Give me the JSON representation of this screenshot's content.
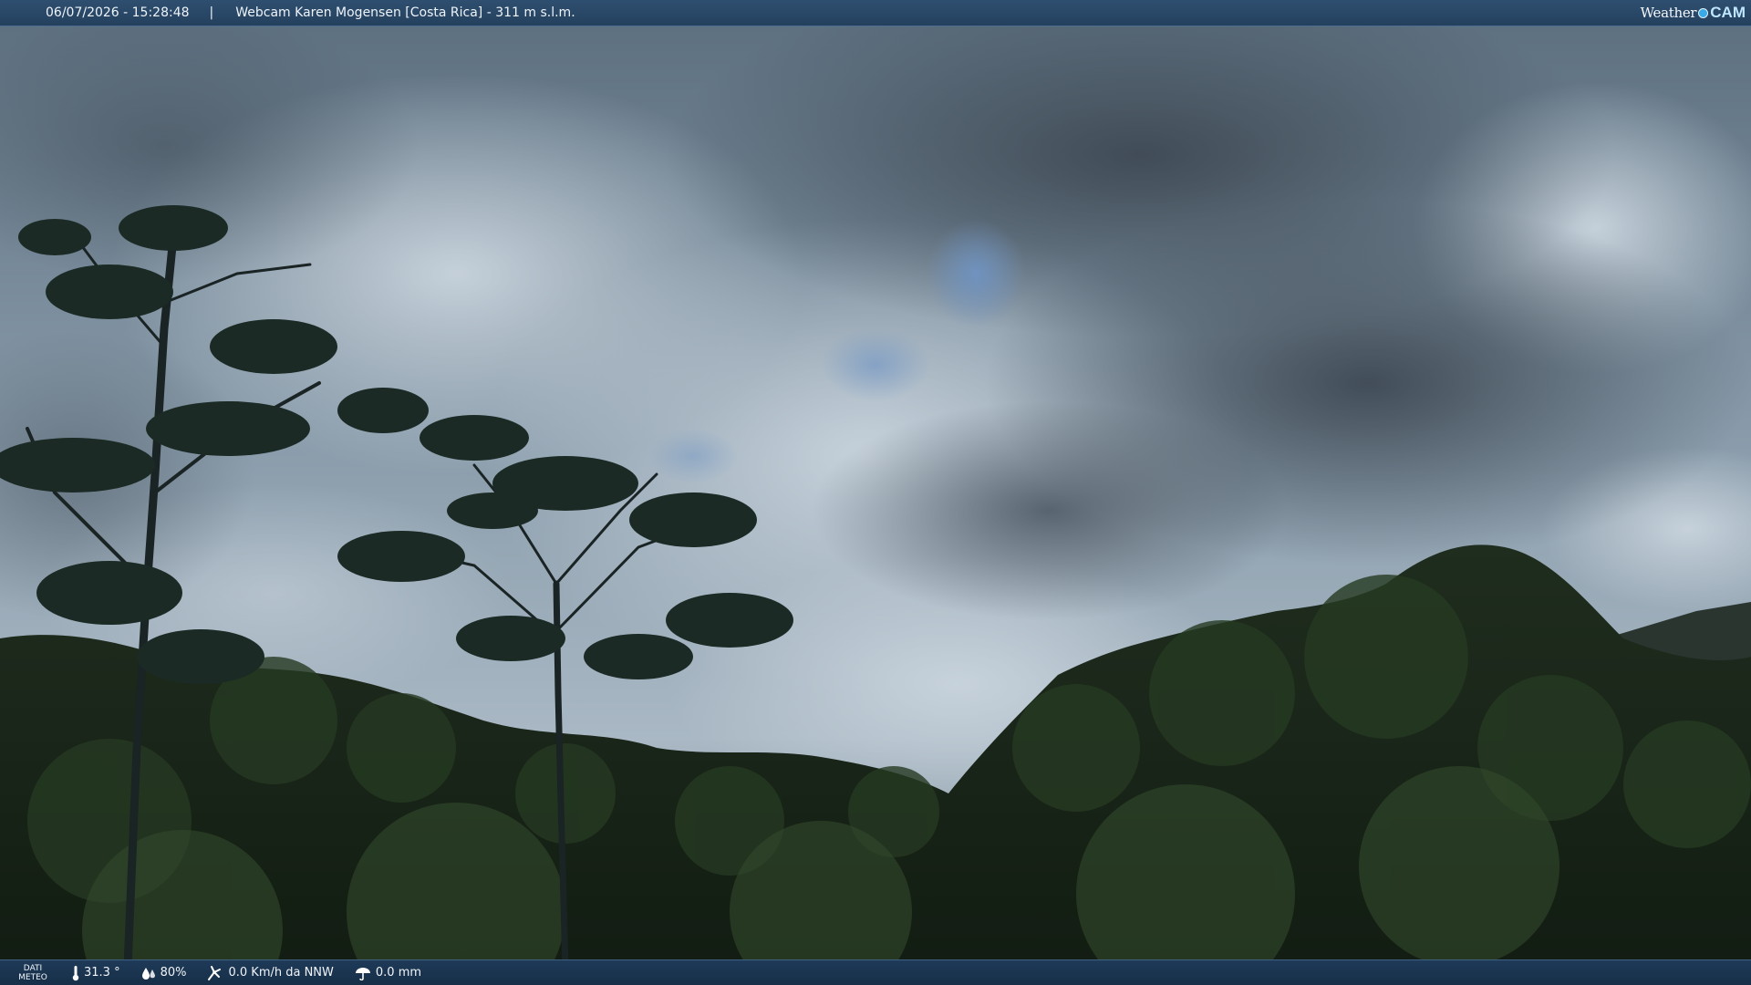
{
  "header": {
    "datetime": "06/07/2026 - 15:28:48",
    "separator": "|",
    "title": "Webcam Karen Mogensen [Costa Rica]  - 311 m s.l.m.",
    "logo_weather": "Weather",
    "logo_cam": "CAM"
  },
  "footer": {
    "label_line1": "DATI",
    "label_line2": "METEO",
    "temperature": "31.3 °",
    "humidity": "80%",
    "wind": "0.0 Km/h da NNW",
    "rain": "0.0 mm",
    "icons": [
      "thermometer-icon",
      "humidity-icon",
      "wind-icon",
      "rain-icon"
    ]
  },
  "colors": {
    "bar": "#24405e",
    "accent": "#39a9e8"
  }
}
